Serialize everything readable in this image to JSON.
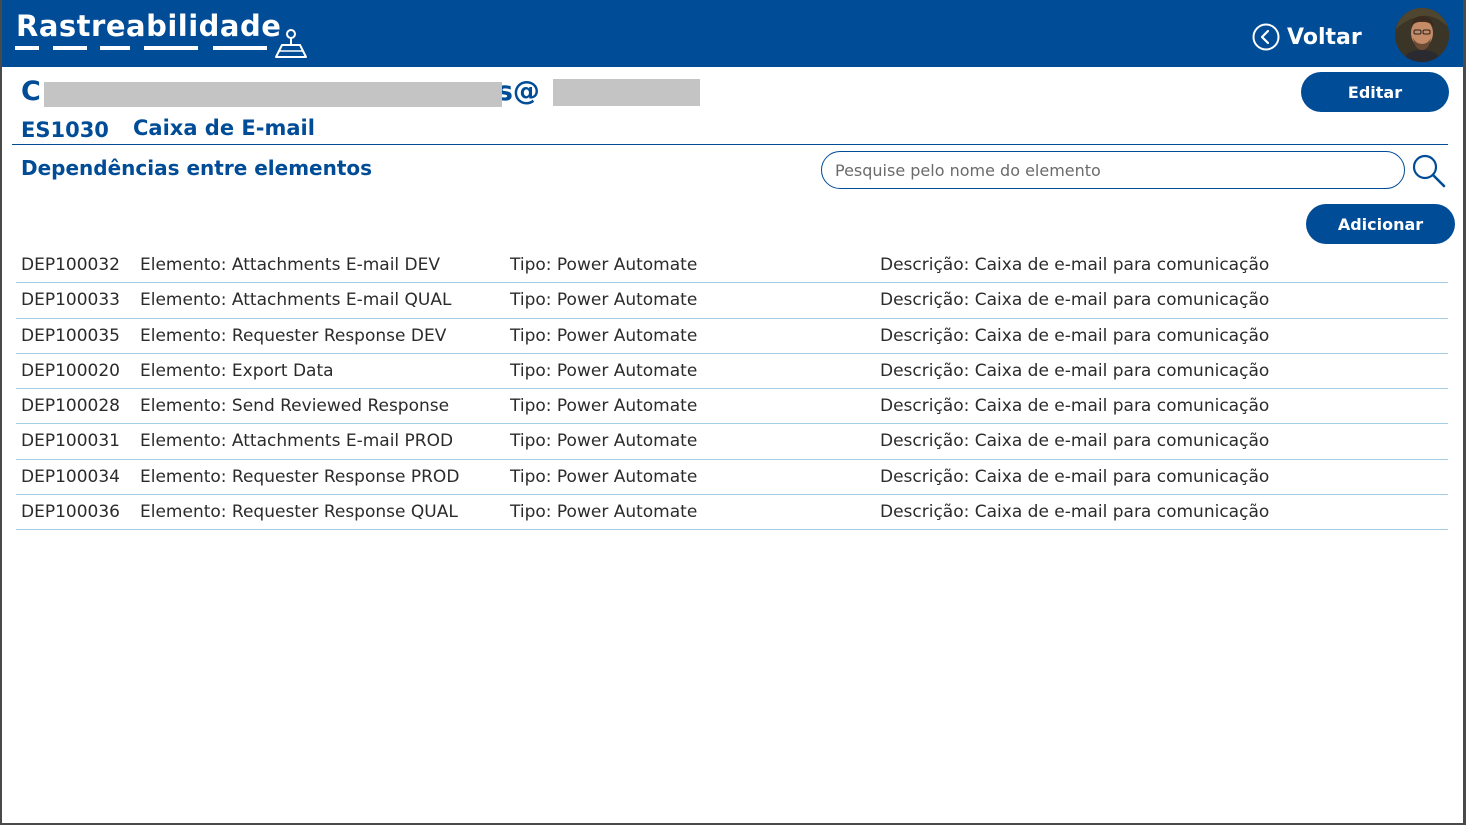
{
  "app": {
    "title": "Rastreabilidade",
    "back_label": "Voltar",
    "brand_color": "#004c97"
  },
  "header": {
    "email_start": "C",
    "email_mid": "s@",
    "element_code": "ES1030",
    "element_name": "Caixa de E-mail",
    "edit_label": "Editar"
  },
  "dependencies": {
    "title": "Dependências entre elementos",
    "search_placeholder": "Pesquise pelo nome do elemento",
    "add_label": "Adicionar",
    "rows": [
      {
        "id": "DEP100032",
        "elemento": "Elemento: Attachments E-mail DEV",
        "tipo": "Tipo: Power Automate",
        "descricao": "Descrição: Caixa de e-mail para comunicação"
      },
      {
        "id": "DEP100033",
        "elemento": "Elemento: Attachments E-mail QUAL",
        "tipo": "Tipo: Power Automate",
        "descricao": "Descrição: Caixa de e-mail para comunicação"
      },
      {
        "id": "DEP100035",
        "elemento": "Elemento: Requester Response DEV",
        "tipo": "Tipo: Power Automate",
        "descricao": "Descrição: Caixa de e-mail para comunicação"
      },
      {
        "id": "DEP100020",
        "elemento": "Elemento: Export Data",
        "tipo": "Tipo: Power Automate",
        "descricao": "Descrição: Caixa de e-mail para comunicação"
      },
      {
        "id": "DEP100028",
        "elemento": "Elemento: Send Reviewed Response",
        "tipo": "Tipo: Power Automate",
        "descricao": "Descrição: Caixa de e-mail para comunicação"
      },
      {
        "id": "DEP100031",
        "elemento": "Elemento: Attachments E-mail PROD",
        "tipo": "Tipo: Power Automate",
        "descricao": "Descrição: Caixa de e-mail para comunicação"
      },
      {
        "id": "DEP100034",
        "elemento": "Elemento: Requester Response PROD",
        "tipo": "Tipo: Power Automate",
        "descricao": "Descrição: Caixa de e-mail para comunicação"
      },
      {
        "id": "DEP100036",
        "elemento": "Elemento: Requester Response QUAL",
        "tipo": "Tipo: Power Automate",
        "descricao": "Descrição: Caixa de e-mail para comunicação"
      }
    ]
  },
  "icons": {
    "map": "map-pin-icon",
    "back": "chevron-left-circle-icon",
    "search": "search-icon"
  }
}
